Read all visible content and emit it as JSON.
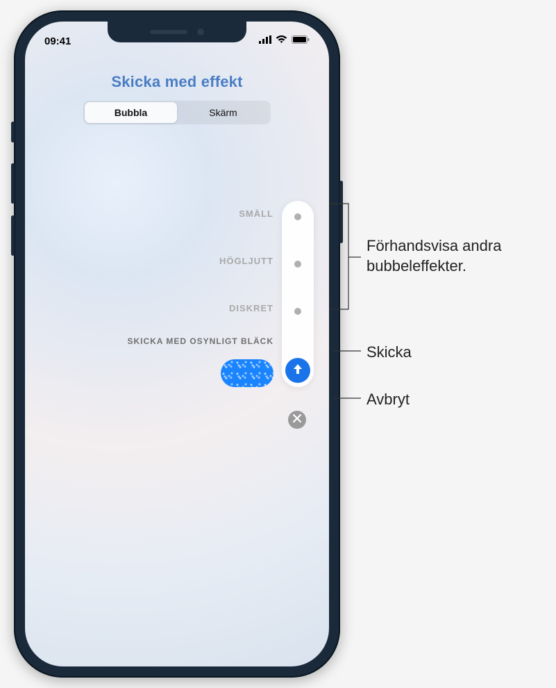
{
  "status": {
    "time": "09:41"
  },
  "header": {
    "title": "Skicka med effekt",
    "tabs": [
      "Bubbla",
      "Skärm"
    ],
    "active_tab": 0
  },
  "effects": {
    "options": [
      "SMÄLL",
      "HÖGLJUTT",
      "DISKRET",
      "SKICKA MED OSYNLIGT BLÄCK"
    ],
    "selected": 3
  },
  "icons": {
    "send": "arrow-up-icon",
    "cancel": "close-icon",
    "cell": "cellular-icon",
    "wifi": "wifi-icon",
    "battery": "battery-icon"
  },
  "annotations": {
    "preview": "Förhandsvisa andra bubbeleffekter.",
    "send": "Skicka",
    "cancel": "Avbryt"
  },
  "colors": {
    "accent": "#1a73e8",
    "link": "#4a7dc4"
  }
}
